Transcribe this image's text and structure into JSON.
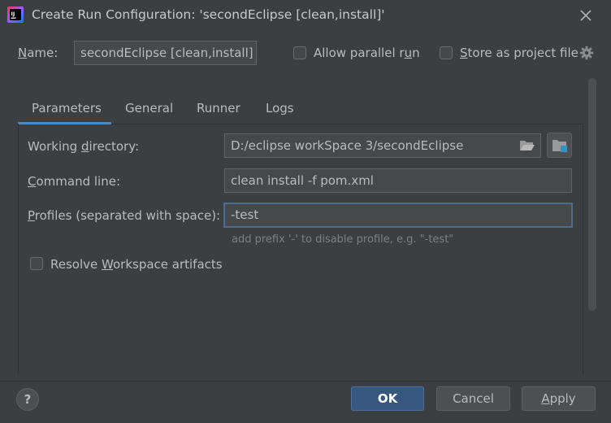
{
  "window": {
    "title": "Create Run Configuration: 'secondEclipse [clean,install]'"
  },
  "name_row": {
    "label": "Name:",
    "value": "secondEclipse [clean,install]",
    "allow_parallel": {
      "label": "Allow parallel run",
      "checked": false
    },
    "store_as_project": {
      "label": "Store as project file",
      "checked": false
    }
  },
  "tabs": [
    {
      "label": "Parameters",
      "selected": true
    },
    {
      "label": "General",
      "selected": false
    },
    {
      "label": "Runner",
      "selected": false
    },
    {
      "label": "Logs",
      "selected": false
    }
  ],
  "params": {
    "working_dir": {
      "label": "Working directory:",
      "value": "D:/eclipse workSpace 3/secondEclipse"
    },
    "command_line": {
      "label": "Command line:",
      "value": "clean install -f pom.xml"
    },
    "profiles": {
      "label": "Profiles (separated with space):",
      "value": "-test",
      "hint": "add prefix '-' to disable profile, e.g. \"-test\""
    },
    "resolve_workspace": {
      "label": "Resolve Workspace artifacts",
      "checked": false
    }
  },
  "buttons": {
    "help": "?",
    "ok": "OK",
    "cancel": "Cancel",
    "apply": "Apply"
  },
  "colors": {
    "background": "#3c3f41",
    "accent": "#4a88c7",
    "primary_button": "#365880"
  },
  "icons": [
    "intellij-app-icon",
    "close-icon",
    "gear-icon",
    "folder-open-icon",
    "module-folder-icon",
    "help-icon"
  ]
}
